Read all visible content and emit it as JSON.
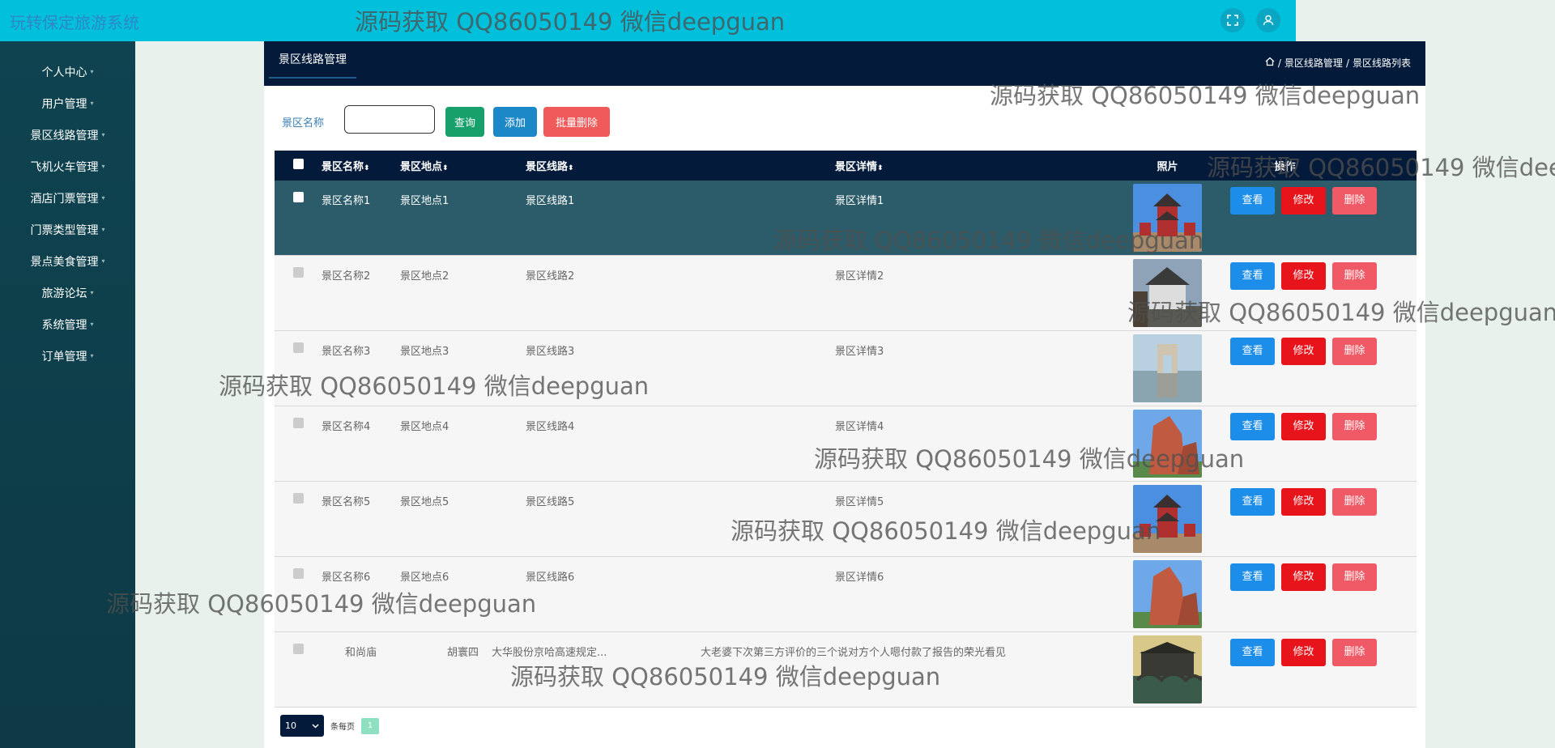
{
  "app": {
    "title": "玩转保定旅游系统"
  },
  "header": {
    "icons": [
      "fullscreen-icon",
      "user-icon"
    ]
  },
  "sidebar": {
    "items": [
      {
        "label": "个人中心"
      },
      {
        "label": "用户管理"
      },
      {
        "label": "景区线路管理"
      },
      {
        "label": "飞机火车管理"
      },
      {
        "label": "酒店门票管理"
      },
      {
        "label": "门票类型管理"
      },
      {
        "label": "景点美食管理"
      },
      {
        "label": "旅游论坛"
      },
      {
        "label": "系统管理"
      },
      {
        "label": "订单管理"
      }
    ]
  },
  "panel": {
    "tab": "景区线路管理",
    "breadcrumb": [
      "景区线路管理",
      "景区线路列表"
    ],
    "breadcrumb_sep": "/"
  },
  "search": {
    "label": "景区名称",
    "input_value": "",
    "query_label": "查询",
    "add_label": "添加",
    "batch_delete_label": "批量删除"
  },
  "table": {
    "columns": [
      "景区名称",
      "景区地点",
      "景区线路",
      "景区详情",
      "照片",
      "操作"
    ],
    "sort_icon": "⬍",
    "actions": {
      "view": "查看",
      "edit": "修改",
      "delete": "删除"
    },
    "rows": [
      {
        "name": "景区名称1",
        "place": "景区地点1",
        "route": "景区线路1",
        "detail": "景区详情1",
        "photo": "tower-photo",
        "selected": true
      },
      {
        "name": "景区名称2",
        "place": "景区地点2",
        "route": "景区线路2",
        "detail": "景区详情2",
        "photo": "temple-photo",
        "selected": false
      },
      {
        "name": "景区名称3",
        "place": "景区地点3",
        "route": "景区线路3",
        "detail": "景区详情3",
        "photo": "arch-photo",
        "selected": false
      },
      {
        "name": "景区名称4",
        "place": "景区地点4",
        "route": "景区线路4",
        "detail": "景区详情4",
        "photo": "rock-photo",
        "selected": false
      },
      {
        "name": "景区名称5",
        "place": "景区地点5",
        "route": "景区线路5",
        "detail": "景区详情5",
        "photo": "tower-photo",
        "selected": false
      },
      {
        "name": "景区名称6",
        "place": "景区地点6",
        "route": "景区线路6",
        "detail": "景区详情6",
        "photo": "rock-photo",
        "selected": false
      },
      {
        "name": "和尚庙",
        "place": "胡寰四",
        "route": "大华股份京哈高速规定...",
        "detail": "大老婆下次第三方评价的三个说对方个人嗯付款了报告的荣光看见",
        "photo": "bridge-photo",
        "selected": false
      }
    ]
  },
  "pager": {
    "page_size": "10",
    "page_size_label": "条每页",
    "current_page": "1"
  },
  "watermark": {
    "text": "源码获取 QQ86050149 微信deepguan"
  }
}
